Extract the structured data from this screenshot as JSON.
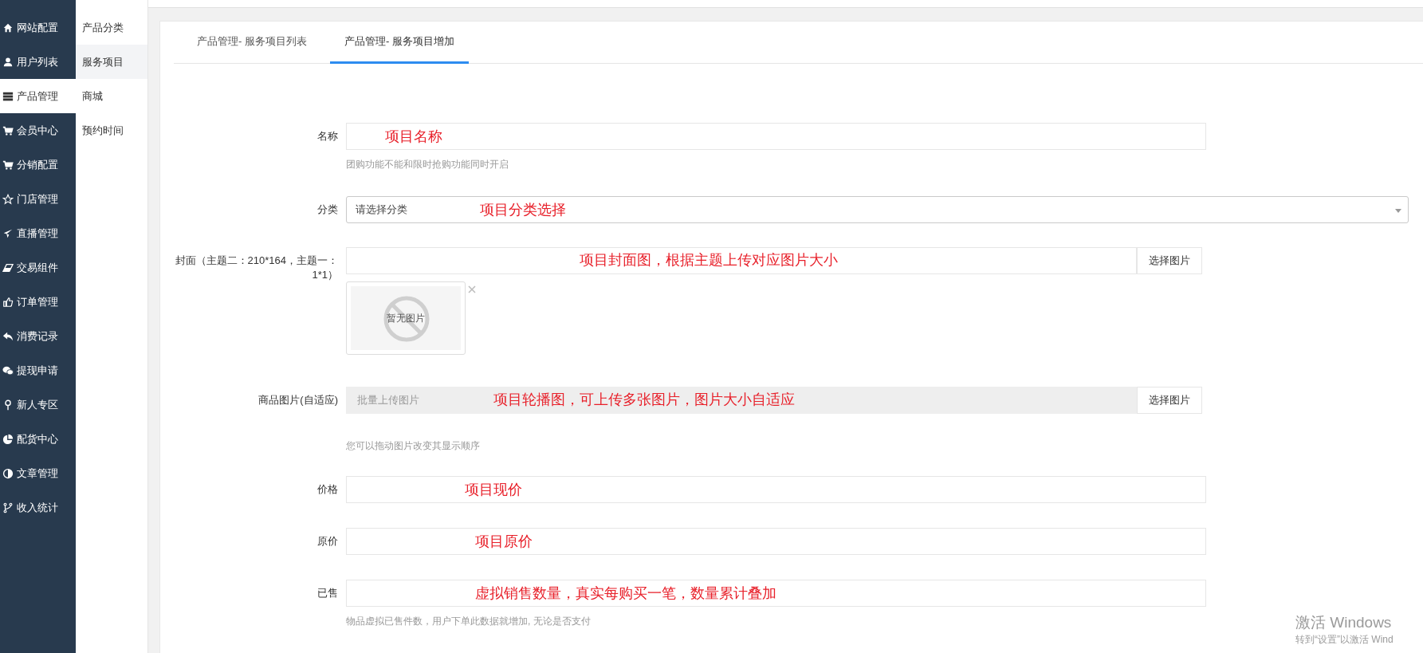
{
  "sidebar": {
    "items": [
      {
        "label": "网站配置",
        "selected": false
      },
      {
        "label": "用户列表",
        "selected": false
      },
      {
        "label": "产品管理",
        "selected": true
      },
      {
        "label": "会员中心",
        "selected": false
      },
      {
        "label": "分销配置",
        "selected": false
      },
      {
        "label": "门店管理",
        "selected": false
      },
      {
        "label": "直播管理",
        "selected": false
      },
      {
        "label": "交易组件",
        "selected": false
      },
      {
        "label": "订单管理",
        "selected": false
      },
      {
        "label": "消费记录",
        "selected": false
      },
      {
        "label": "提现申请",
        "selected": false
      },
      {
        "label": "新人专区",
        "selected": false
      },
      {
        "label": "配货中心",
        "selected": false
      },
      {
        "label": "文章管理",
        "selected": false
      },
      {
        "label": "收入统计",
        "selected": false
      }
    ]
  },
  "submenu": {
    "items": [
      {
        "label": "产品分类",
        "selected": false
      },
      {
        "label": "服务项目",
        "selected": true
      },
      {
        "label": "商城",
        "selected": false
      },
      {
        "label": "预约时间",
        "selected": false
      }
    ]
  },
  "tabs": [
    {
      "label": "产品管理- 服务项目列表",
      "selected": false
    },
    {
      "label": "产品管理- 服务项目增加",
      "selected": true
    }
  ],
  "form": {
    "fields": [
      {
        "kind": "text",
        "label": "名称",
        "annotation": "项目名称",
        "help": "团购功能不能和限时抢购功能同时开启"
      },
      {
        "kind": "select",
        "label": "分类",
        "placeholder": "请选择分类",
        "annotation": "项目分类选择"
      },
      {
        "kind": "image",
        "label": "封面（主题二：210*164，主题一：1*1）",
        "annotation": "项目封面图，根据主题上传对应图片大小",
        "button": "选择图片",
        "preview_text": "暂无图片"
      },
      {
        "kind": "images",
        "label": "商品图片(自适应)",
        "placeholder": "批量上传图片",
        "annotation": "项目轮播图，可上传多张图片，图片大小自适应",
        "button": "选择图片",
        "help": "您可以拖动图片改变其显示顺序"
      },
      {
        "kind": "text",
        "label": "价格",
        "annotation": "项目现价"
      },
      {
        "kind": "text",
        "label": "原价",
        "annotation": "项目原价"
      },
      {
        "kind": "text",
        "label": "已售",
        "annotation": "虚拟销售数量，真实每购买一笔，数量累计叠加",
        "help": "物品虚拟已售件数，用户下单此数据就增加, 无论是否支付"
      }
    ]
  },
  "activation_notice": {
    "title": "激活 Windows",
    "text": "转到“设置”以激活 Wind"
  }
}
